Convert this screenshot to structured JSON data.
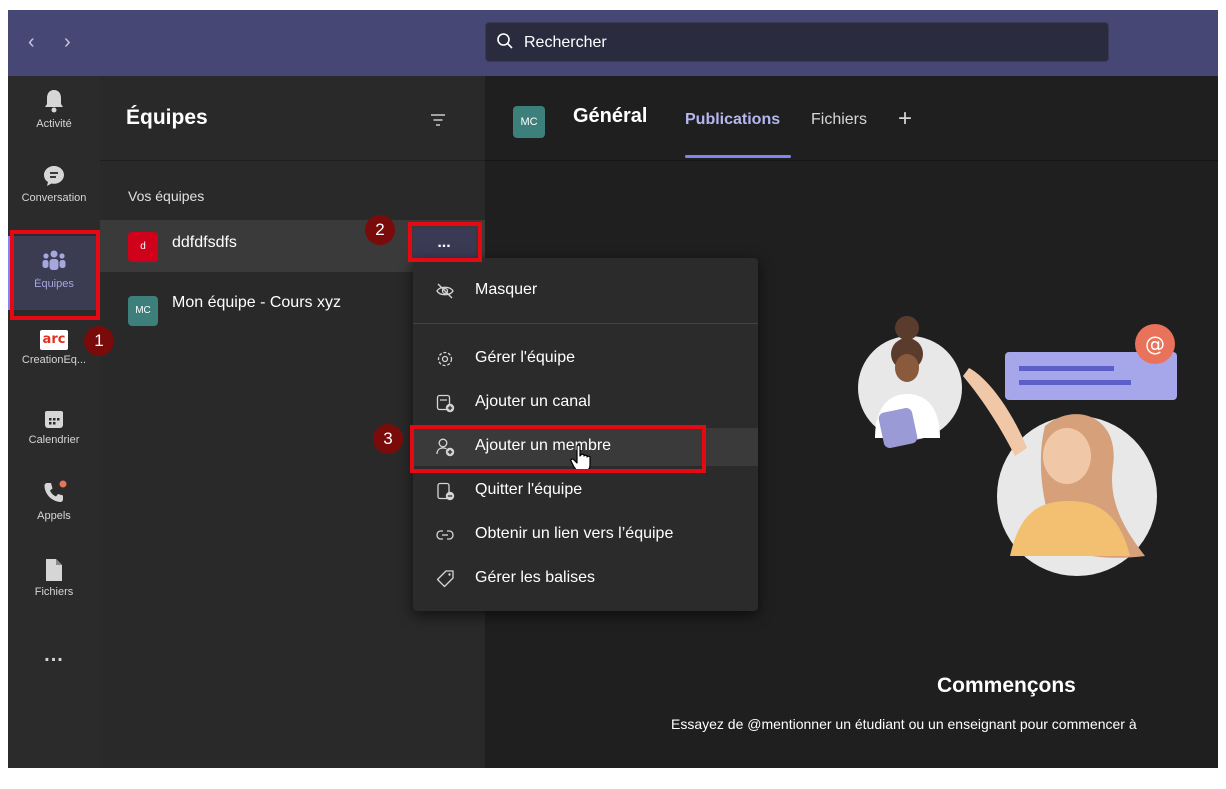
{
  "search": {
    "placeholder": "Rechercher"
  },
  "rail": {
    "items": [
      {
        "label": "Activité",
        "icon": "bell-icon"
      },
      {
        "label": "Conversation",
        "icon": "chat-icon"
      },
      {
        "label": "Équipes",
        "icon": "teams-icon"
      },
      {
        "label": "CreationEq...",
        "icon": "arc-app-icon",
        "icon_text": "arc"
      },
      {
        "label": "Calendrier",
        "icon": "calendar-icon"
      },
      {
        "label": "Appels",
        "icon": "phone-icon"
      },
      {
        "label": "Fichiers",
        "icon": "file-icon"
      },
      {
        "label": "...",
        "icon": "more-apps-icon"
      }
    ]
  },
  "teams_panel": {
    "title": "Équipes",
    "section_label": "Vos équipes",
    "teams": [
      {
        "avatar": "d",
        "name": "ddfdfsdfs",
        "color": "#d0021b"
      },
      {
        "avatar": "MC",
        "name": "Mon équipe - Cours xyz",
        "color": "#3d7f7a"
      }
    ]
  },
  "more_button": {
    "label": "..."
  },
  "context_menu": {
    "items": [
      {
        "label": "Masquer",
        "icon": "hide-icon"
      },
      {
        "label": "Gérer l'équipe",
        "icon": "settings-icon"
      },
      {
        "label": "Ajouter un canal",
        "icon": "add-channel-icon"
      },
      {
        "label": "Ajouter un membre",
        "icon": "add-member-icon"
      },
      {
        "label": "Quitter l'équipe",
        "icon": "leave-team-icon"
      },
      {
        "label": "Obtenir un lien vers l’équipe",
        "icon": "link-icon"
      },
      {
        "label": "Gérer les balises",
        "icon": "tag-icon"
      }
    ]
  },
  "channel": {
    "avatar": "MC",
    "name": "Général",
    "tabs": [
      "Publications",
      "Fichiers"
    ],
    "active_tab": "Publications",
    "add_tab": "+"
  },
  "welcome": {
    "title": "Commençons",
    "text": "Essayez de @mentionner un étudiant ou un enseignant pour commencer à"
  },
  "annotations": {
    "step1": "1",
    "step2": "2",
    "step3": "3"
  },
  "colors": {
    "accent": "#7f85f5",
    "titlebar": "#464775",
    "highlight": "#e50914"
  }
}
